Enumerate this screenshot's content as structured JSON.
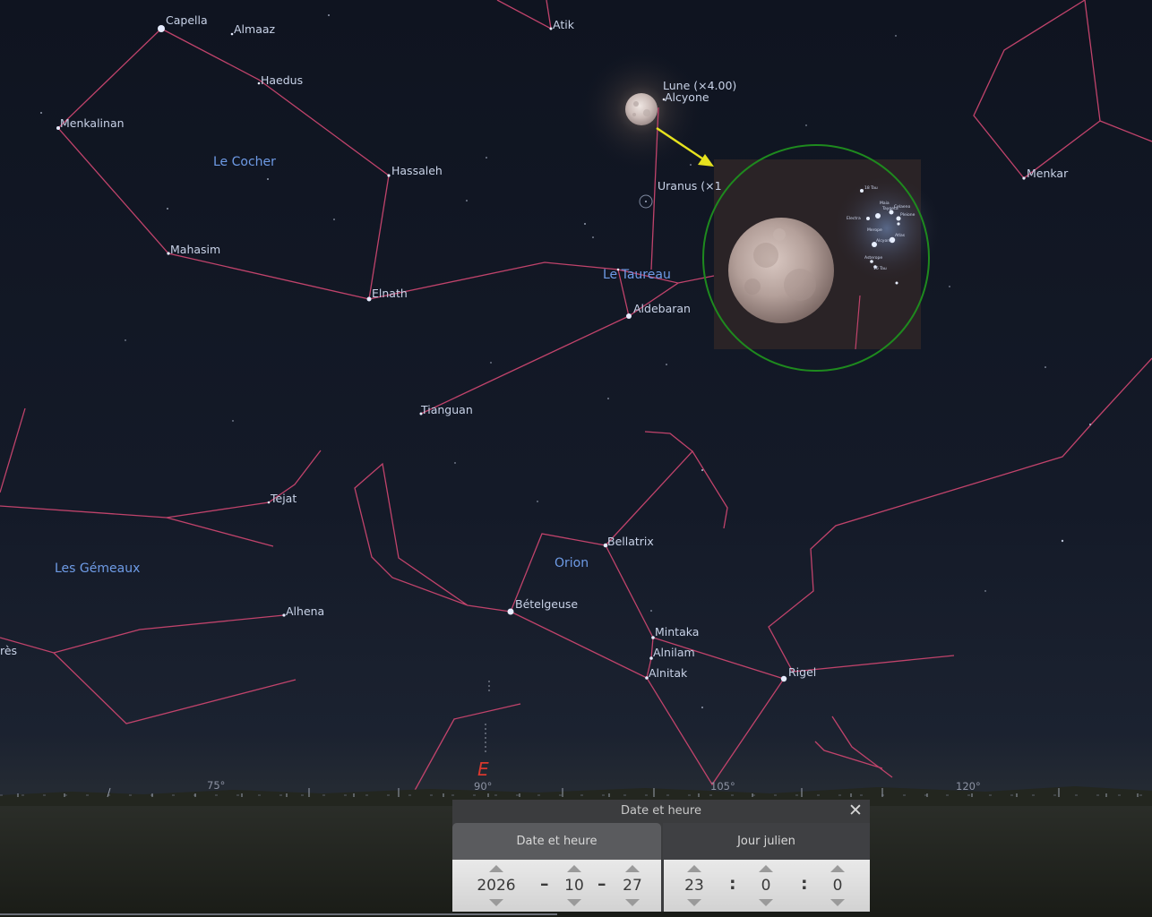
{
  "sky": {
    "star_labels": {
      "capella": "Capella",
      "almaaz": "Almaaz",
      "haedus": "Haedus",
      "menkalinan": "Menkalinan",
      "hassaleh": "Hassaleh",
      "mahasim": "Mahasim",
      "elnath": "Elnath",
      "atik": "Atik",
      "alcyone": "Alcyone",
      "uranus": "Uranus (×1",
      "aldebaran": "Aldebaran",
      "tianguan": "Tianguan",
      "menkar": "Menkar",
      "tejat": "Tejat",
      "alhena": "Alhena",
      "ceres": "rès",
      "bellatrix": "Bellatrix",
      "betelgeuse": "Bételgeuse",
      "mintaka": "Mintaka",
      "alnilam": "Alnilam",
      "alnitak": "Alnitak",
      "rigel": "Rigel"
    },
    "moon_label": "Lune (×4.00)",
    "constellations": {
      "auriga": "Le Cocher",
      "taurus": "Le Taureau",
      "gemini": "Les Gémeaux",
      "orion": "Orion"
    },
    "cardinal": "E",
    "azimuth_ticks": [
      "75°",
      "90°",
      "105°",
      "120°"
    ],
    "colors": {
      "constellation_lines": "#c0436b",
      "constellation_labels": "#6e9be6",
      "cardinal": "#d9382e",
      "inset_ring": "#1e8a1e",
      "pointer_arrow": "#e6e21e"
    }
  },
  "inset": {
    "cluster_labels": {
      "t18": "18 Tau",
      "maia": "Maia",
      "taygeta": "Taygeta",
      "electra": "Electra",
      "celaeno": "Celaeno",
      "merope": "Merope",
      "pleione": "Pleione",
      "atlas": "Atlas",
      "alcyone": "Alcyone",
      "asterope": "Asterope",
      "t16": "16 Tau"
    }
  },
  "dialog": {
    "title": "Date et heure",
    "close_icon": "close-icon",
    "tabs": {
      "date_time": "Date et heure",
      "julian_day": "Jour julien"
    },
    "date": {
      "year": "2026",
      "month": "10",
      "day": "27",
      "separator": "–"
    },
    "time": {
      "hour": "23",
      "minute": "0",
      "second": "0",
      "separator": ":"
    }
  }
}
